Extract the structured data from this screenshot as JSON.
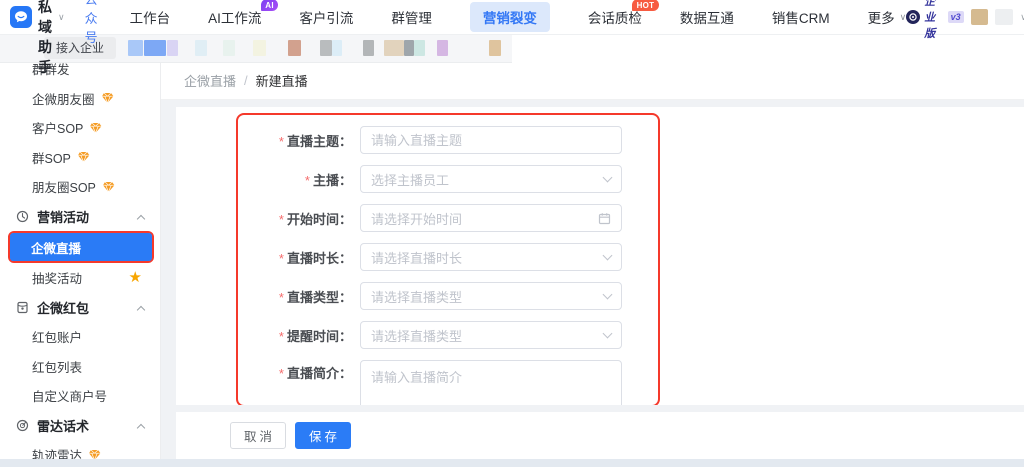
{
  "topnav": {
    "logo": {
      "title": "芝麻私域助手",
      "caret": "∨",
      "subtitle": "公众号"
    },
    "items": [
      {
        "label": "工作台"
      },
      {
        "label": "AI工作流",
        "badge": "AI"
      },
      {
        "label": "客户引流"
      },
      {
        "label": "群管理"
      },
      {
        "label": "营销裂变",
        "active": true
      },
      {
        "label": "会话质检",
        "badge": "HOT"
      },
      {
        "label": "数据互通"
      },
      {
        "label": "销售CRM"
      },
      {
        "label": "更多",
        "caret": "∨"
      }
    ],
    "edition": {
      "label": "企业版",
      "version": "v3"
    }
  },
  "tabstrip": {
    "connect_label": "接入企业",
    "redacted_blocks": [
      "#a9c8f8",
      "#7da8f5",
      "#d9d4f4",
      "#e0eef5",
      "#e8f2ee",
      "#f3f3e1",
      "#d2a18e",
      "#b9bcbe",
      "#dcedf7",
      "#b3b6b8",
      "#e2d3bd",
      "#9fa6ab",
      "#cde7e3",
      "#d5b7e3",
      "#dfc49e"
    ]
  },
  "sidebar": {
    "items": [
      {
        "type": "item",
        "label": "群群发"
      },
      {
        "type": "item",
        "label": "企微朋友圈",
        "gem": true
      },
      {
        "type": "item",
        "label": "客户SOP",
        "gem": true
      },
      {
        "type": "item",
        "label": "群SOP",
        "gem": true
      },
      {
        "type": "item",
        "label": "朋友圈SOP",
        "gem": true
      },
      {
        "type": "section",
        "label": "营销活动",
        "icon": "marketing"
      },
      {
        "type": "selected",
        "label": "企微直播"
      },
      {
        "type": "item",
        "label": "抽奖活动",
        "star": true
      },
      {
        "type": "section",
        "label": "企微红包",
        "icon": "redpacket"
      },
      {
        "type": "item",
        "label": "红包账户"
      },
      {
        "type": "item",
        "label": "红包列表"
      },
      {
        "type": "item",
        "label": "自定义商户号"
      },
      {
        "type": "section",
        "label": "雷达话术",
        "icon": "radar"
      },
      {
        "type": "item",
        "label": "轨迹雷达",
        "gem": true
      }
    ]
  },
  "breadcrumb": {
    "parent": "企微直播",
    "separator": "/",
    "current": "新建直播"
  },
  "form": {
    "required_mark": "*",
    "fields": [
      {
        "label": "直播主题：",
        "placeholder": "请输入直播主题",
        "type": "input"
      },
      {
        "label": "主播：",
        "placeholder": "选择主播员工",
        "type": "select"
      },
      {
        "label": "开始时间：",
        "placeholder": "请选择开始时间",
        "type": "date"
      },
      {
        "label": "直播时长：",
        "placeholder": "请选择直播时长",
        "type": "select"
      },
      {
        "label": "直播类型：",
        "placeholder": "请选择直播类型",
        "type": "select"
      },
      {
        "label": "提醒时间：",
        "placeholder": "请选择直播类型",
        "type": "select"
      },
      {
        "label": "直播简介：",
        "placeholder": "请输入直播简介",
        "type": "textarea"
      }
    ],
    "cancel_label": "取消",
    "save_label": "保存"
  },
  "colors": {
    "primary": "#2b7cf6",
    "annotation_red": "#f5392b",
    "nav_active_bg": "#dce8fb",
    "gem_orange": "#f59b22",
    "star_orange": "#f7a500",
    "ai_badge": "#8a3ff2",
    "hot_badge": "#f75b41"
  }
}
